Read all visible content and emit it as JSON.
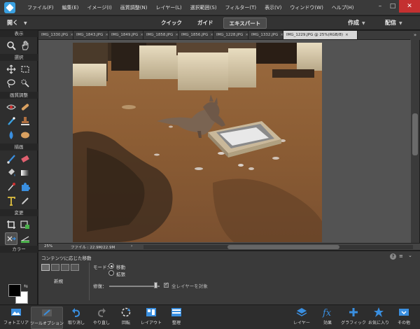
{
  "menu": [
    "ファイル(F)",
    "編集(E)",
    "イメージ(I)",
    "画質調整(N)",
    "レイヤー(L)",
    "選択範囲(S)",
    "フィルター(T)",
    "表示(V)",
    "ウィンドウ(W)",
    "ヘルプ(H)"
  ],
  "topbar": {
    "open_label": "開く",
    "modes": [
      "クイック",
      "ガイド",
      "エキスパート"
    ],
    "active_mode": "エキスパート",
    "create_label": "作成",
    "share_label": "配信"
  },
  "toolbox": {
    "sections": [
      "表示",
      "選択",
      "画質調整",
      "描画",
      "変更",
      "カラー"
    ],
    "tools": [
      "zoom-tool",
      "hand-tool",
      "move-tool",
      "rect-marquee-tool",
      "lasso-tool",
      "quick-select-tool",
      "red-eye-tool",
      "spot-heal-tool",
      "smart-brush-tool",
      "clone-stamp-tool",
      "blur-tool",
      "sponge-tool",
      "brush-tool",
      "eraser-tool",
      "paint-bucket-tool",
      "gradient-tool",
      "eyedropper-tool",
      "custom-shape-tool",
      "type-tool",
      "pencil-tool",
      "crop-tool",
      "recompose-tool",
      "content-aware-move-tool",
      "straighten-tool"
    ],
    "foreground_color": "#000000",
    "background_color": "#ffffff"
  },
  "document_tabs": [
    "IMG_1330.JPG",
    "IMG_1843.JPG",
    "IMG_1849.JPG",
    "IMG_1858.JPG",
    "IMG_1856.JPG",
    "IMG_1228.JPG",
    "IMG_1332.JPG",
    "IMG_1229.JPG @ 25%(RGB/8)"
  ],
  "active_document": "IMG_1229.JPG @ 25%(RGB/8)",
  "status": {
    "zoom": "25%",
    "file_info": "ファイル : 22.9M/22.9M"
  },
  "tool_options": {
    "title": "コンテンツに応じた移動",
    "new_label": "新規",
    "mode_label": "モード：",
    "mode_options": [
      "移動",
      "拡張"
    ],
    "selected_mode": "移動",
    "healing_label": "修復：",
    "healing_value": 0.93,
    "all_layers_label": "全レイヤーを対象",
    "all_layers_checked": true
  },
  "taskbar": {
    "items": [
      "フォトエリア",
      "ツールオプション",
      "取り消し",
      "やり直し",
      "回転",
      "レイアウト",
      "整理",
      "レイヤー",
      "効果",
      "グラフィック",
      "お気に入り",
      "その他"
    ],
    "active": "ツールオプション"
  },
  "colors": {
    "accent_blue": "#2a8fd6",
    "close_red": "#c43030"
  }
}
